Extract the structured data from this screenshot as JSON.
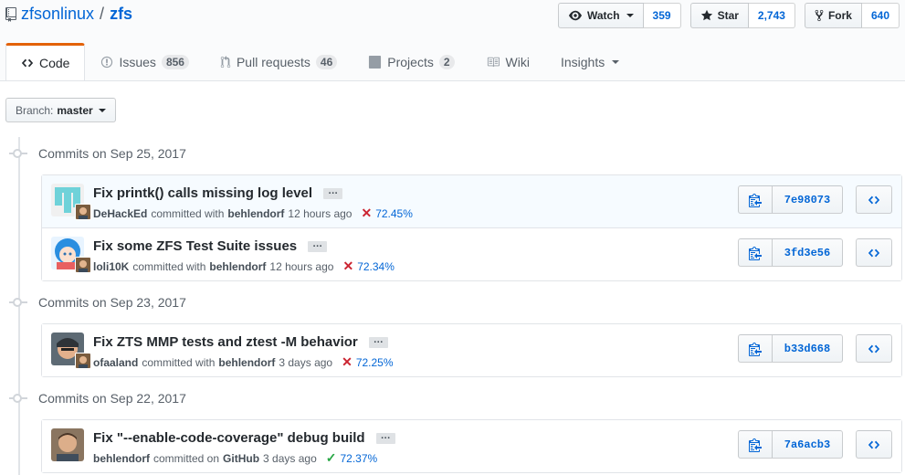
{
  "repo": {
    "owner": "zfsonlinux",
    "separator": "/",
    "name": "zfs"
  },
  "actions": {
    "watch": {
      "label": "Watch",
      "count": "359"
    },
    "star": {
      "label": "Star",
      "count": "2,743"
    },
    "fork": {
      "label": "Fork",
      "count": "640"
    }
  },
  "tabs": [
    {
      "label": "Code"
    },
    {
      "label": "Issues",
      "count": "856"
    },
    {
      "label": "Pull requests",
      "count": "46"
    },
    {
      "label": "Projects",
      "count": "2"
    },
    {
      "label": "Wiki"
    },
    {
      "label": "Insights"
    }
  ],
  "branch": {
    "prefix": "Branch:",
    "name": "master"
  },
  "groups": [
    {
      "title": "Commits on Sep 25, 2017",
      "commits": [
        {
          "message": "Fix printk() calls missing log level",
          "author": "DeHackEd",
          "verb": "committed with",
          "committer": "behlendorf",
          "time": "12 hours ago",
          "status": "fail",
          "coverage": "72.45%",
          "sha": "7e98073"
        },
        {
          "message": "Fix some ZFS Test Suite issues",
          "author": "loli10K",
          "verb": "committed with",
          "committer": "behlendorf",
          "time": "12 hours ago",
          "status": "fail",
          "coverage": "72.34%",
          "sha": "3fd3e56"
        }
      ]
    },
    {
      "title": "Commits on Sep 23, 2017",
      "commits": [
        {
          "message": "Fix ZTS MMP tests and ztest -M behavior",
          "author": "ofaaland",
          "verb": "committed with",
          "committer": "behlendorf",
          "time": "3 days ago",
          "status": "fail",
          "coverage": "72.25%",
          "sha": "b33d668"
        }
      ]
    },
    {
      "title": "Commits on Sep 22, 2017",
      "commits": [
        {
          "message": "Fix \"--enable-code-coverage\" debug build",
          "author": "behlendorf",
          "verb": "committed on",
          "committer": "GitHub",
          "time": "3 days ago",
          "status": "success",
          "coverage": "72.37%",
          "sha": "7a6acb3"
        }
      ]
    }
  ],
  "ellipsis": "…",
  "status_icons": {
    "fail": "✕",
    "success": "✓"
  },
  "colors": {
    "accent": "#0366d6",
    "tab_indicator": "#e36209",
    "fail": "#cb2431",
    "success": "#28a745"
  }
}
